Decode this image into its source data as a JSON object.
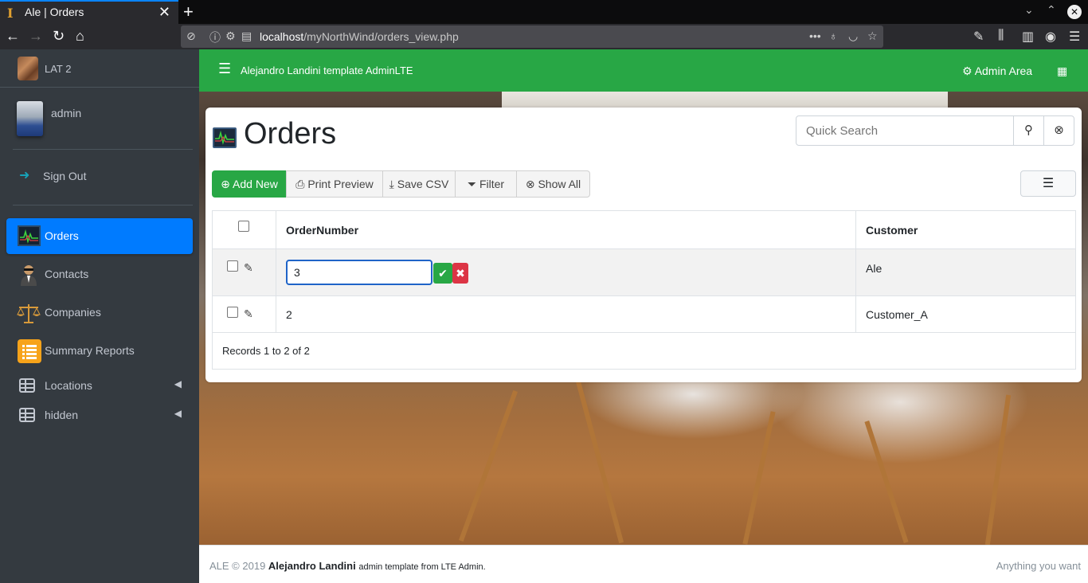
{
  "browser": {
    "tab_title": "Ale | Orders",
    "url_host": "localhost",
    "url_path": "/myNorthWind/orders_view.php"
  },
  "sidebar": {
    "brand": "LAT 2",
    "user": "admin",
    "signout": "Sign Out",
    "items": [
      {
        "label": "Orders",
        "icon": "chart-monitor-icon",
        "active": true
      },
      {
        "label": "Contacts",
        "icon": "agent-icon"
      },
      {
        "label": "Companies",
        "icon": "scales-icon"
      },
      {
        "label": "Summary Reports",
        "icon": "list-report-icon"
      },
      {
        "label": "Locations",
        "icon": "table-icon",
        "expandable": true
      },
      {
        "label": "hidden",
        "icon": "table-icon",
        "expandable": true
      }
    ]
  },
  "header": {
    "title": "Alejandro Landini template AdminLTE",
    "admin_area": "Admin Area"
  },
  "page": {
    "title": "Orders",
    "search_placeholder": "Quick Search"
  },
  "toolbar": {
    "add_new": "Add New",
    "print_preview": "Print Preview",
    "save_csv": "Save CSV",
    "filter": "Filter",
    "show_all": "Show All"
  },
  "table": {
    "columns": [
      "OrderNumber",
      "Customer"
    ],
    "rows": [
      {
        "order_number": "3",
        "customer": "Ale",
        "editing": true
      },
      {
        "order_number": "2",
        "customer": "Customer_A"
      }
    ],
    "records": "Records 1 to 2 of 2"
  },
  "footer": {
    "prefix": "ALE © 2019",
    "author": "Alejandro Landini",
    "suffix": "admin template from LTE Admin.",
    "right": "Anything you want"
  },
  "colors": {
    "header": "#28a745",
    "sidebar": "#343a40",
    "active": "#007bff",
    "danger": "#dc3545"
  }
}
